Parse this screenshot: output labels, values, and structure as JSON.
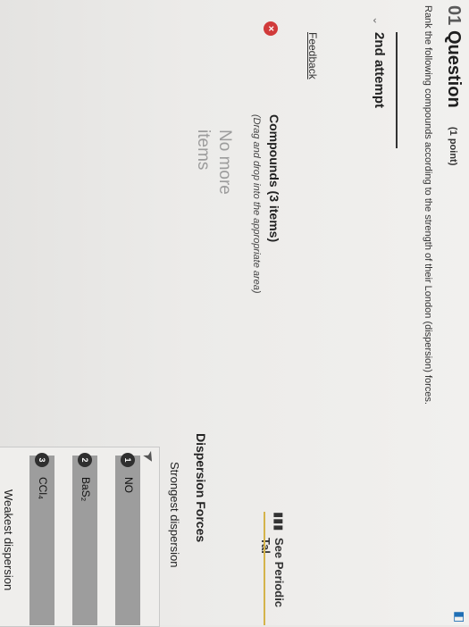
{
  "question": {
    "number": "01",
    "title": "Question",
    "points": "(1 point)",
    "prompt": "Rank the following compounds according to the strength of their London (dispersion) forces."
  },
  "attempt": {
    "label": "2nd attempt"
  },
  "feedback": {
    "label": "Feedback"
  },
  "compounds": {
    "title": "Compounds (3 items)",
    "subtitle": "(Drag and drop into the appropriate area)",
    "empty_line1": "No more",
    "empty_line2": "items"
  },
  "periodic": {
    "label": "See Periodic Tal",
    "icon": "bar-chart-icon"
  },
  "ranking": {
    "title": "Dispersion Forces",
    "strongest": "Strongest dispersion",
    "weakest": "Weakest dispersion",
    "items": [
      {
        "rank": "1",
        "label": "NO"
      },
      {
        "rank": "2",
        "label": "BaS₂"
      },
      {
        "rank": "3",
        "label": "CCl₄"
      }
    ]
  },
  "colors": {
    "error": "#d13a3a",
    "accent_underline": "#d4b34a",
    "item_fill": "#9d9d9d"
  }
}
